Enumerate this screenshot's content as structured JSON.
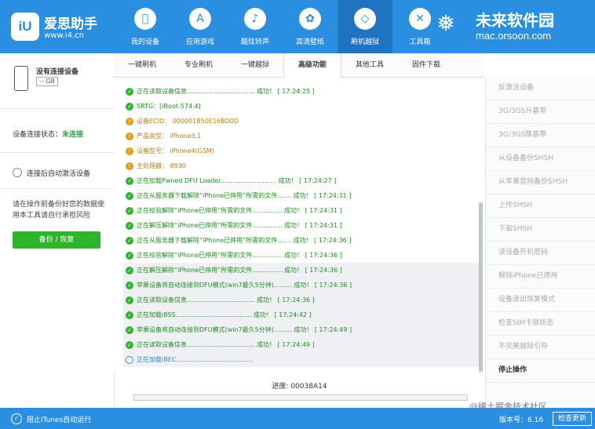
{
  "brand": {
    "logo": "iU",
    "name": "爱思助手",
    "url": "www.i4.cn"
  },
  "nav": [
    {
      "label": "我的设备",
      "icon": "apple-icon",
      "glyph": ""
    },
    {
      "label": "应用游戏",
      "icon": "app-store-icon",
      "glyph": "A"
    },
    {
      "label": "酷炫铃声",
      "icon": "bell-icon",
      "glyph": "♪"
    },
    {
      "label": "高清壁纸",
      "icon": "wallpaper-icon",
      "glyph": "✿"
    },
    {
      "label": "刷机越狱",
      "icon": "box-icon",
      "glyph": "◇"
    },
    {
      "label": "工具箱",
      "icon": "tools-icon",
      "glyph": "✕"
    }
  ],
  "watermark": {
    "name": "未来软件园",
    "url": "mac.orsoon.com"
  },
  "device": {
    "name": "没有连接设备",
    "capacity": "-- GB"
  },
  "status": {
    "label": "设备连接状态：",
    "value": "未连接"
  },
  "auto_activate": "连接后自动激活设备",
  "warning": "请在操作前备份好您的数据使用本工具请自行承担风险",
  "backup_button": "备份 / 恢复",
  "tabs": [
    "一键刷机",
    "专业刷机",
    "一键越狱",
    "高级功能",
    "其他工具",
    "固件下载"
  ],
  "active_tab": 3,
  "log": [
    {
      "type": "ok",
      "text": "正在读取设备信息..................................  成功！ [ 17:24:25 ]"
    },
    {
      "type": "ok",
      "text": "SRTG：[iBoot-574.4]"
    },
    {
      "type": "info",
      "text": "设备ECID： 000001B50E16BD0D"
    },
    {
      "type": "info",
      "text": "产品类型： iPhone3,1"
    },
    {
      "type": "info",
      "text": "设备型号： iPhone4(GSM)"
    },
    {
      "type": "info",
      "text": "主处理器： 8930"
    },
    {
      "type": "ok",
      "text": "正在加载Pwned DFU Loader............................  成功！ [ 17:24:27 ]"
    },
    {
      "type": "ok",
      "text": "正在从服务器下载解除“iPhone已停用”所需的文件.......  成功！ [ 17:24:31 ]"
    },
    {
      "type": "ok",
      "text": "正在校验解除“iPhone已停用”所需的文件...............  成功！ [ 17:24:31 ]"
    },
    {
      "type": "ok",
      "text": "正在解压解除“iPhone已停用”所需的文件...............  成功！ [ 17:24:31 ]"
    },
    {
      "type": "ok",
      "text": "正在从服务器下载解除“iPhone已停用”所需的文件.......  成功！ [ 17:24:36 ]"
    },
    {
      "type": "ok",
      "text": "正在校验解除“iPhone已停用”所需的文件...............  成功！ [ 17:24:36 ]"
    },
    {
      "type": "ok",
      "text": "正在解压解除“iPhone已停用”所需的文件...............  成功！ [ 17:24:36 ]"
    },
    {
      "type": "ok",
      "text": "苹果设备将自动连接到DFU模式(win7最久5分钟).........  成功！ [ 17:24:36 ]"
    },
    {
      "type": "ok",
      "text": "正在读取设备信息..................................  成功！ [ 17:24:36 ]"
    },
    {
      "type": "ok",
      "text": "正在加载iBSS......................................  成功！ [ 17:24:42 ]"
    },
    {
      "type": "ok",
      "text": "苹果设备将自动连接到DFU模式(win7最久5分钟).........  成功！ [ 17:24:49 ]"
    },
    {
      "type": "ok",
      "text": "正在读取设备信息..................................  成功！ [ 17:24:49 ]"
    },
    {
      "type": "run",
      "text": "正在加载iBEC......................................."
    }
  ],
  "progress": {
    "label": "进度: 00038A14",
    "fraction": 0
  },
  "right_menu": [
    "反激活设备",
    "3G/3GS升基带",
    "3G/3GS降基带",
    "从设备备份SHSH",
    "从苹果官网备份SHSH",
    "上传SHSH",
    "下载SHSH",
    "读设备开机密码",
    "解除iPhone已停用",
    "设备退出恢复模式",
    "检查SIM卡锁状态",
    "不完美越狱引导",
    "停止操作"
  ],
  "right_menu_enabled": [
    "停止操作"
  ],
  "statusbar": {
    "label": "阻止iTunes自动运行",
    "version": "版本号：6.16",
    "update": "检查更新",
    "watermark": "@稀土掘金技术社区"
  },
  "colors": {
    "primary": "#2a8fe0",
    "success": "#2eb52c",
    "info": "#e79b1d"
  }
}
